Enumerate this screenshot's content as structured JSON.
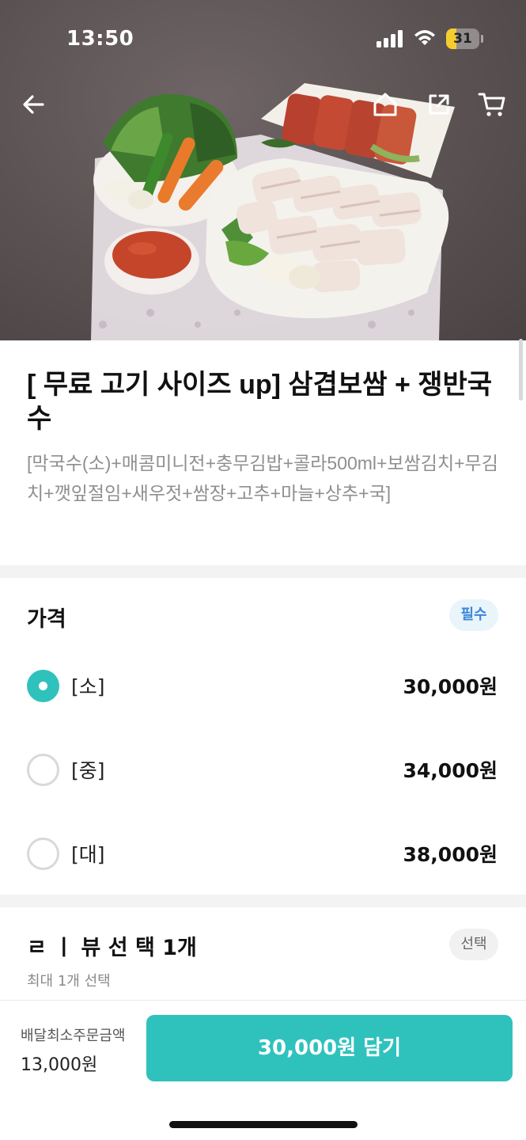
{
  "status_bar": {
    "time": "13:50",
    "battery": "31",
    "battery_level": 0.31
  },
  "hero": {
    "alt": "삼겹보쌈 상차림 사진"
  },
  "nav": {
    "back_icon": "back-arrow-icon",
    "home_icon": "home-icon",
    "share_icon": "share-icon",
    "cart_icon": "cart-icon"
  },
  "product": {
    "title": "[ 무료 고기 사이즈 up] 삼겹보쌈 + 쟁반국수",
    "description": "[막국수(소)+매콤미니전+충무김밥+콜라500ml+보쌈김치+무김치+깻잎절임+새우젓+쌈장+고추+마늘+상추+국]"
  },
  "price_section": {
    "title": "가격",
    "badge": "필수",
    "options": [
      {
        "label": "[소]",
        "price": "30,000원",
        "selected": true
      },
      {
        "label": "[중]",
        "price": "34,000원",
        "selected": false
      },
      {
        "label": "[대]",
        "price": "38,000원",
        "selected": false
      }
    ]
  },
  "extra_section": {
    "title": "ㄹ ㅣ 뷰 선 택 1개",
    "badge": "선택",
    "subtitle": "최대 1개 선택"
  },
  "bottom_bar": {
    "min_order_label": "배달최소주문금액",
    "min_order_value": "13,000원",
    "cta_label": "30,000원 담기"
  },
  "colors": {
    "accent": "#2fc2bd",
    "required_badge": "#3a86d8"
  }
}
